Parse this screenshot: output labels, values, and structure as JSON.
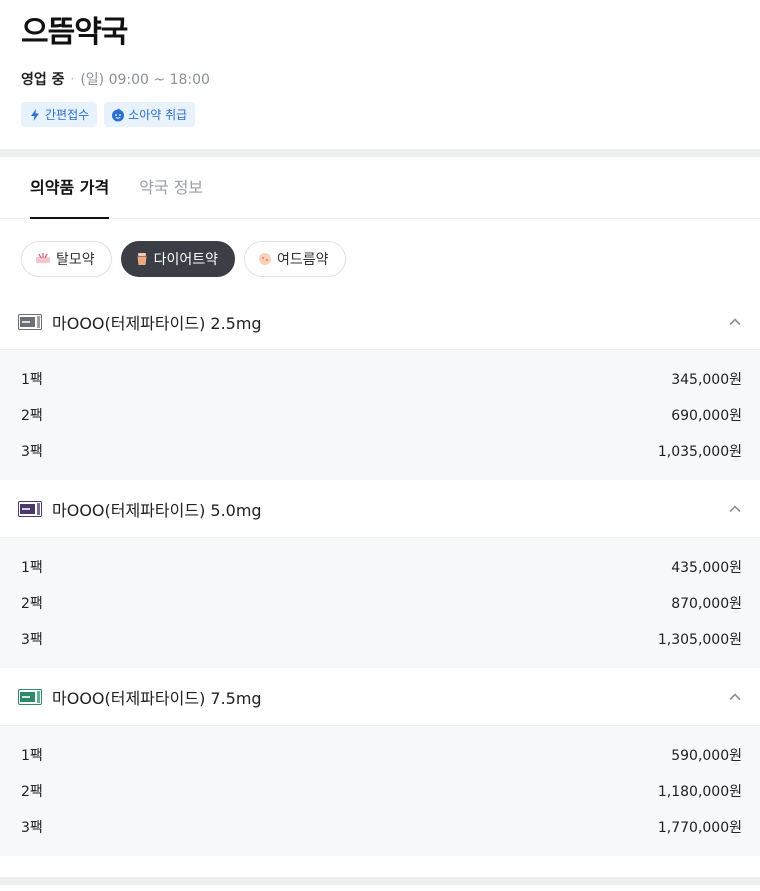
{
  "pharmacy": {
    "name": "으뜸약국",
    "status": "영업 중",
    "separator": "·",
    "hours": "(일) 09:00 ~ 18:00",
    "badges": [
      {
        "label": "간편접수",
        "icon": "lightning-icon"
      },
      {
        "label": "소아약 취급",
        "icon": "child-face-icon"
      }
    ]
  },
  "tabs": [
    {
      "label": "의약품 가격",
      "active": true
    },
    {
      "label": "약국 정보",
      "active": false
    }
  ],
  "chips": [
    {
      "label": "탈모약",
      "icon": "hair-loss-icon",
      "active": false
    },
    {
      "label": "다이어트약",
      "icon": "diet-icon",
      "active": true
    },
    {
      "label": "여드름약",
      "icon": "acne-icon",
      "active": false
    }
  ],
  "colors": {
    "accent_blue": "#2a6fd6",
    "chip_active": "#3b3e44",
    "pkg_2_5": "#6b6f76",
    "pkg_5_0": "#4a3a6b",
    "pkg_7_5": "#2e8a6a"
  },
  "products": [
    {
      "name": "마OOO(터제파타이드) 2.5mg",
      "rows": [
        {
          "qty": "1팩",
          "price": "345,000원"
        },
        {
          "qty": "2팩",
          "price": "690,000원"
        },
        {
          "qty": "3팩",
          "price": "1,035,000원"
        }
      ]
    },
    {
      "name": "마OOO(터제파타이드) 5.0mg",
      "rows": [
        {
          "qty": "1팩",
          "price": "435,000원"
        },
        {
          "qty": "2팩",
          "price": "870,000원"
        },
        {
          "qty": "3팩",
          "price": "1,305,000원"
        }
      ]
    },
    {
      "name": "마OOO(터제파타이드) 7.5mg",
      "rows": [
        {
          "qty": "1팩",
          "price": "590,000원"
        },
        {
          "qty": "2팩",
          "price": "1,180,000원"
        },
        {
          "qty": "3팩",
          "price": "1,770,000원"
        }
      ]
    }
  ]
}
